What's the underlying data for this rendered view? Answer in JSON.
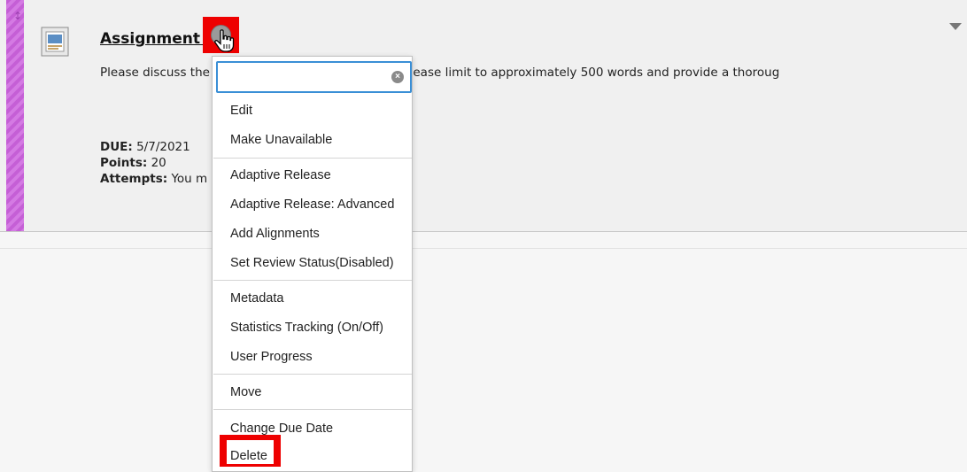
{
  "item": {
    "title": "Assignment 1",
    "description": "Please discuss the                          human body. In your response, please limit to approximately 500 words and provide a thoroug",
    "due_label": "DUE:",
    "due_value": "5/7/2021",
    "points_label": "Points:",
    "points_value": "20",
    "attempts_label": "Attempts:",
    "attempts_value": "You m                                                    once."
  },
  "menu": {
    "search_placeholder": "",
    "items": [
      "Edit",
      "Make Unavailable",
      "Adaptive Release",
      "Adaptive Release: Advanced",
      "Add Alignments",
      "Set Review Status(Disabled)",
      "Metadata",
      "Statistics Tracking (On/Off)",
      "User Progress",
      "Move",
      "Change Due Date",
      "Delete"
    ]
  },
  "colors": {
    "drag_bar": "#c55fd6",
    "highlight": "#ee0000",
    "search_border": "#3a8fd6"
  },
  "icons": {
    "drag": "drag-handle-icon",
    "assignment": "assignment-icon",
    "chevron": "contextual-menu-chevron-icon",
    "cursor": "hand-pointer-icon",
    "clear": "clear-search-icon",
    "options": "options-arrow-icon"
  }
}
